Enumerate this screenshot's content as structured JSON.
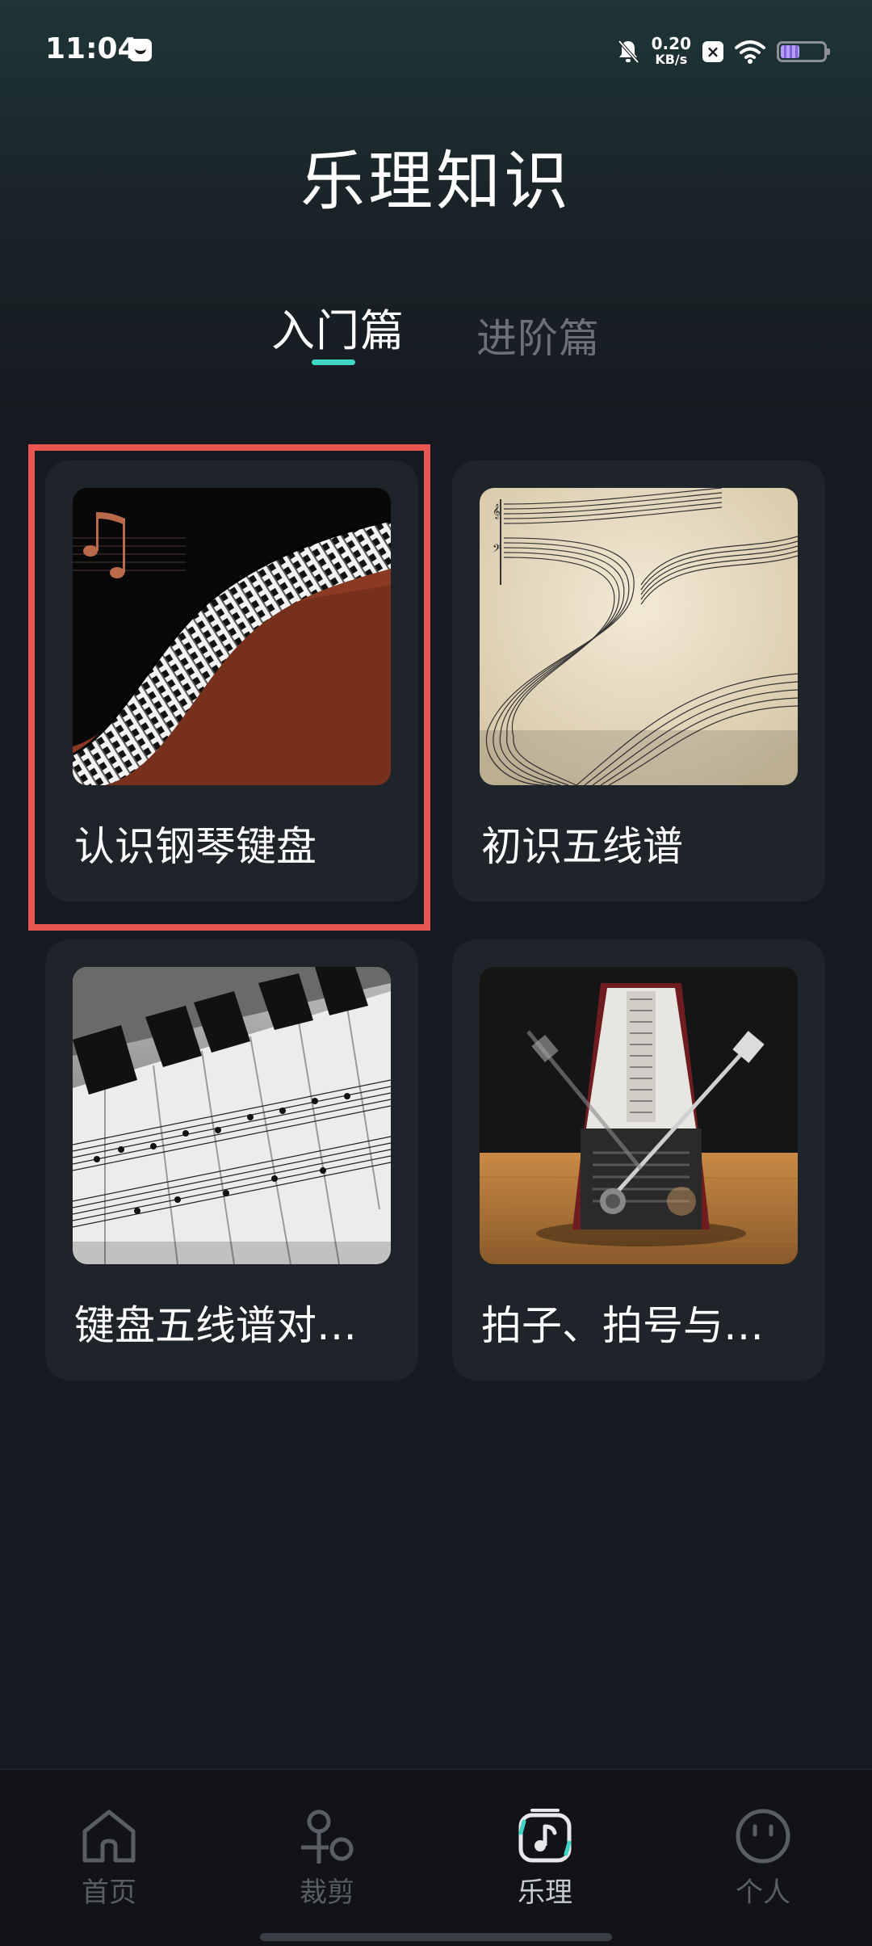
{
  "status_bar": {
    "time": "11:04",
    "net_speed_value": "0.20",
    "net_speed_unit": "KB/s",
    "battery_level": 0.45
  },
  "header": {
    "title": "乐理知识"
  },
  "tabs": [
    {
      "label": "入门篇",
      "active": true
    },
    {
      "label": "进阶篇",
      "active": false
    }
  ],
  "cards": [
    {
      "title": "认识钢琴键盘",
      "image": "piano-keyboard-music-note"
    },
    {
      "title": "初识五线谱",
      "image": "staff-sheet-music-swirl"
    },
    {
      "title": "键盘五线谱对…",
      "image": "piano-keys-sheet-music"
    },
    {
      "title": "拍子、拍号与…",
      "image": "metronome"
    }
  ],
  "bottom_nav": [
    {
      "label": "首页",
      "icon": "home-icon",
      "active": false
    },
    {
      "label": "裁剪",
      "icon": "scissors-icon",
      "active": false
    },
    {
      "label": "乐理",
      "icon": "music-note-icon",
      "active": true
    },
    {
      "label": "个人",
      "icon": "face-icon",
      "active": false
    }
  ],
  "colors": {
    "accent": "#3fd6c3",
    "highlight": "#e8574f",
    "background": "#161a20",
    "card": "#1f232a"
  }
}
